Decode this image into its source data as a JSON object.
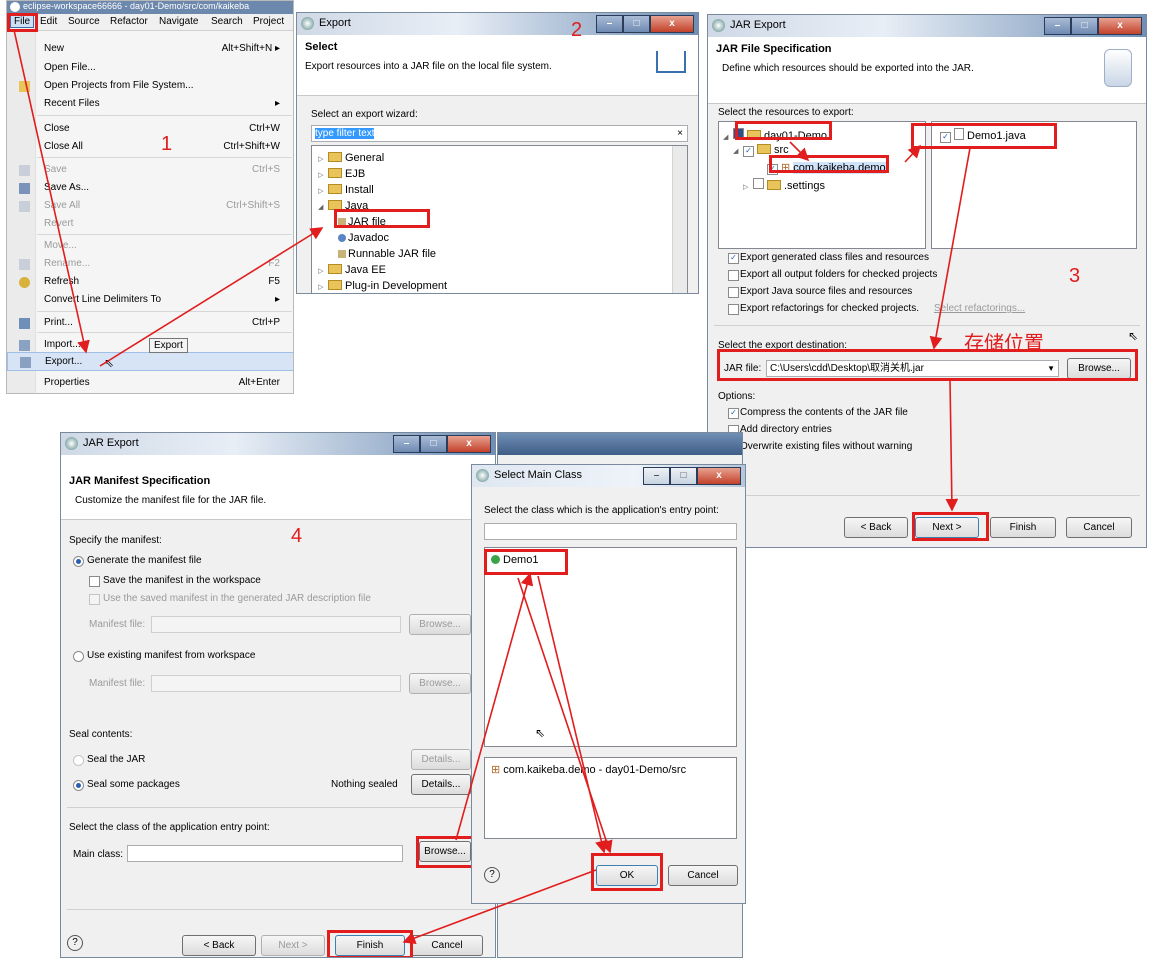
{
  "panel1": {
    "title_text": "eclipse-workspace66666 - day01-Demo/src/com/kaikeba",
    "menubar": [
      "File",
      "Edit",
      "Source",
      "Refactor",
      "Navigate",
      "Search",
      "Project"
    ],
    "items": [
      {
        "label": "New",
        "key": "Alt+Shift+N ▸"
      },
      {
        "label": "Open File...",
        "key": ""
      },
      {
        "label": "Open Projects from File System...",
        "key": ""
      },
      {
        "label": "Recent Files",
        "key": "▸"
      },
      {
        "label": "Close",
        "key": "Ctrl+W"
      },
      {
        "label": "Close All",
        "key": "Ctrl+Shift+W"
      },
      {
        "label": "Save",
        "key": "Ctrl+S"
      },
      {
        "label": "Save As...",
        "key": ""
      },
      {
        "label": "Save All",
        "key": "Ctrl+Shift+S"
      },
      {
        "label": "Revert",
        "key": ""
      },
      {
        "label": "Move...",
        "key": ""
      },
      {
        "label": "Rename...",
        "key": "F2"
      },
      {
        "label": "Refresh",
        "key": "F5"
      },
      {
        "label": "Convert Line Delimiters To",
        "key": "▸"
      },
      {
        "label": "Print...",
        "key": "Ctrl+P"
      },
      {
        "label": "Import...",
        "key": ""
      },
      {
        "label": "Export...",
        "key": ""
      },
      {
        "label": "Properties",
        "key": "Alt+Enter"
      }
    ],
    "tooltip": "Export",
    "step": "1"
  },
  "panel2": {
    "title": "Export",
    "header_title": "Select",
    "header_desc": "Export resources into a JAR file on the local file system.",
    "wizard_label": "Select an export wizard:",
    "filter_value": "type filter text",
    "tree": [
      "General",
      "EJB",
      "Install",
      "Java",
      "JAR file",
      "Javadoc",
      "Runnable JAR file",
      "Java EE",
      "Plug-in Development"
    ],
    "step": "2"
  },
  "panel3": {
    "title": "JAR Export",
    "header_title": "JAR File Specification",
    "header_desc": "Define which resources should be exported into the JAR.",
    "resources_label": "Select the resources to export:",
    "tree": [
      "day01-Demo",
      "src",
      "com.kaikeba.demo",
      ".settings"
    ],
    "file": "Demo1.java",
    "options_export": [
      "Export generated class files and resources",
      "Export all output folders for checked projects",
      "Export Java source files and resources",
      "Export refactorings for checked projects."
    ],
    "select_refactorings": "Select refactorings...",
    "destination_label": "Select the export destination:",
    "jar_label": "JAR file:",
    "jar_value": "C:\\Users\\cdd\\Desktop\\取消关机.jar",
    "browse": "Browse...",
    "options_label": "Options:",
    "options": [
      "Compress the contents of the JAR file",
      "Add directory entries",
      "Overwrite existing files without warning"
    ],
    "annotation": "存储位置",
    "back": "< Back",
    "next": "Next >",
    "finish": "Finish",
    "cancel": "Cancel",
    "step": "3"
  },
  "panel4": {
    "title": "JAR Export",
    "header_title": "JAR Manifest Specification",
    "header_desc": "Customize the manifest file for the JAR file.",
    "specify_label": "Specify the manifest:",
    "generate": "Generate the manifest file",
    "save_ws": "Save the manifest in the workspace",
    "use_saved": "Use the saved manifest in the generated JAR description file",
    "manifest_file": "Manifest file:",
    "browse": "Browse...",
    "use_existing": "Use existing manifest from workspace",
    "seal_contents": "Seal contents:",
    "seal_jar": "Seal the JAR",
    "seal_some": "Seal some packages",
    "nothing_sealed": "Nothing sealed",
    "details": "Details...",
    "entry_label": "Select the class of the application entry point:",
    "main_class": "Main class:",
    "back": "< Back",
    "next": "Next >",
    "finish": "Finish",
    "cancel": "Cancel",
    "help": "?",
    "step": "4"
  },
  "panel5": {
    "title": "Select Main Class",
    "prompt": "Select the class which is the application's entry point:",
    "class_item": "Demo1",
    "package_item": "com.kaikeba.demo - day01-Demo/src",
    "ok": "OK",
    "cancel": "Cancel",
    "help": "?"
  },
  "colors": {
    "annotation_red": "#e11d1d",
    "selection": "#3399ff"
  }
}
